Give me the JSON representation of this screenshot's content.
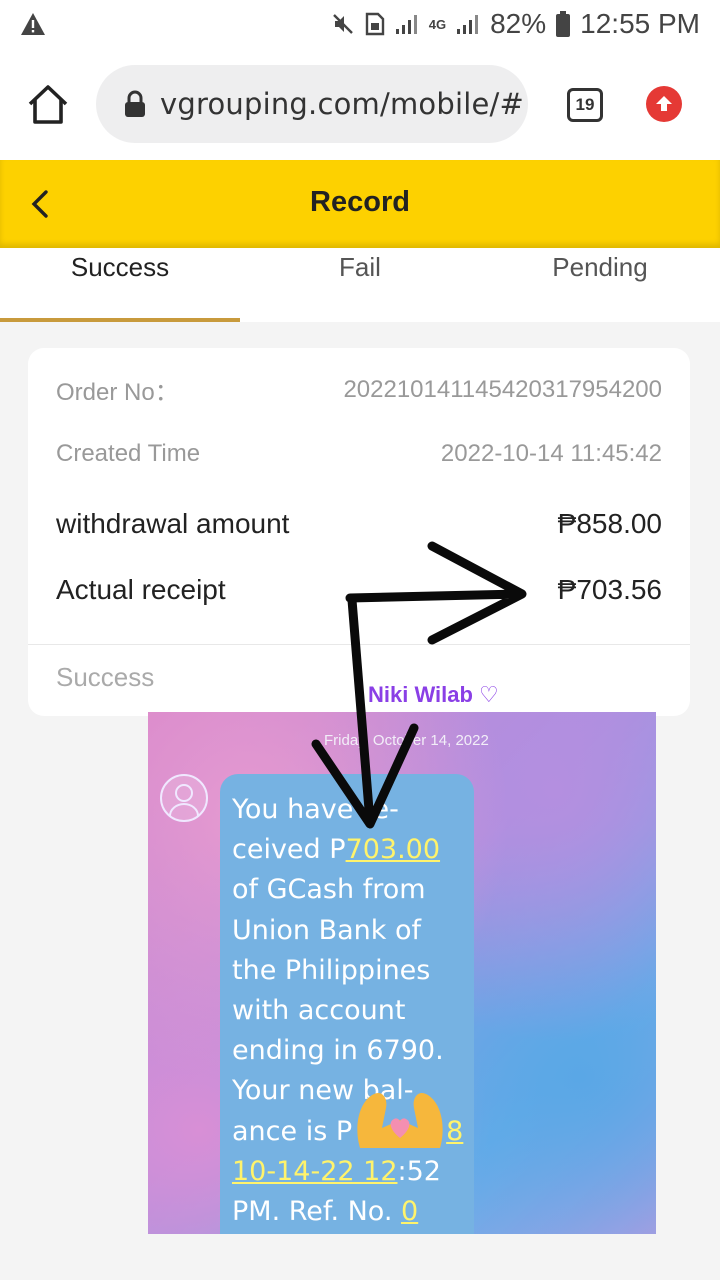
{
  "status_bar": {
    "network": "4G",
    "battery": "82%",
    "time": "12:55 PM"
  },
  "browser": {
    "url": "vgrouping.com/mobile/#",
    "tab_count": "19"
  },
  "header": {
    "title": "Record",
    "accent": "#fdd100"
  },
  "tabs": [
    {
      "label": "Success",
      "active": true
    },
    {
      "label": "Fail",
      "active": false
    },
    {
      "label": "Pending",
      "active": false
    }
  ],
  "record": {
    "order_no_label": "Order No：",
    "order_no": "20221014114542031795420​0",
    "created_label": "Created Time",
    "created": "2022-10-14 11:45:42",
    "withdrawal_label": "withdrawal amount",
    "withdrawal": "₱858.00",
    "receipt_label": "Actual receipt",
    "receipt": "₱703.56",
    "status": "Success"
  },
  "proof": {
    "sender": "Niki Wilab ♡",
    "date": "Friday, October 14, 2022",
    "message": {
      "l1": "You have re-",
      "l2a": "ceived P",
      "l2b": "703.00",
      "l3": "of GCash from",
      "l4": "Union Bank of",
      "l5": "the Philippines",
      "l6": "with account",
      "l7": "ending in 6790.",
      "l8": "Your new bal-",
      "l9a": "ance is P",
      "l9b": "8",
      "l10a": "10-14-22 12",
      "l10b": ":52",
      "l11a": "PM. Ref. No. ",
      "l11b": "0"
    }
  }
}
